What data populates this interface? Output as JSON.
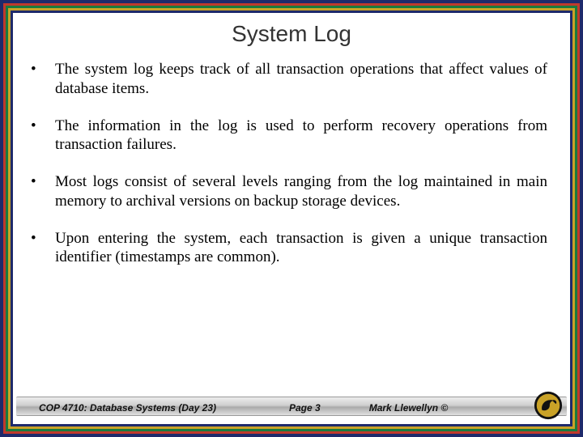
{
  "slide": {
    "title": "System Log",
    "bullets": [
      "The system log keeps track of all transaction operations that affect values of database items.",
      "The information in the log is used to perform recovery operations from transaction failures.",
      "Most logs consist of several levels ranging from the log maintained in main memory to archival versions on backup storage devices.",
      "Upon entering the system, each transaction is given a unique transaction identifier (timestamps are common)."
    ]
  },
  "footer": {
    "course": "COP 4710: Database Systems  (Day 23)",
    "page": "Page 3",
    "author": "Mark Llewellyn ©"
  }
}
